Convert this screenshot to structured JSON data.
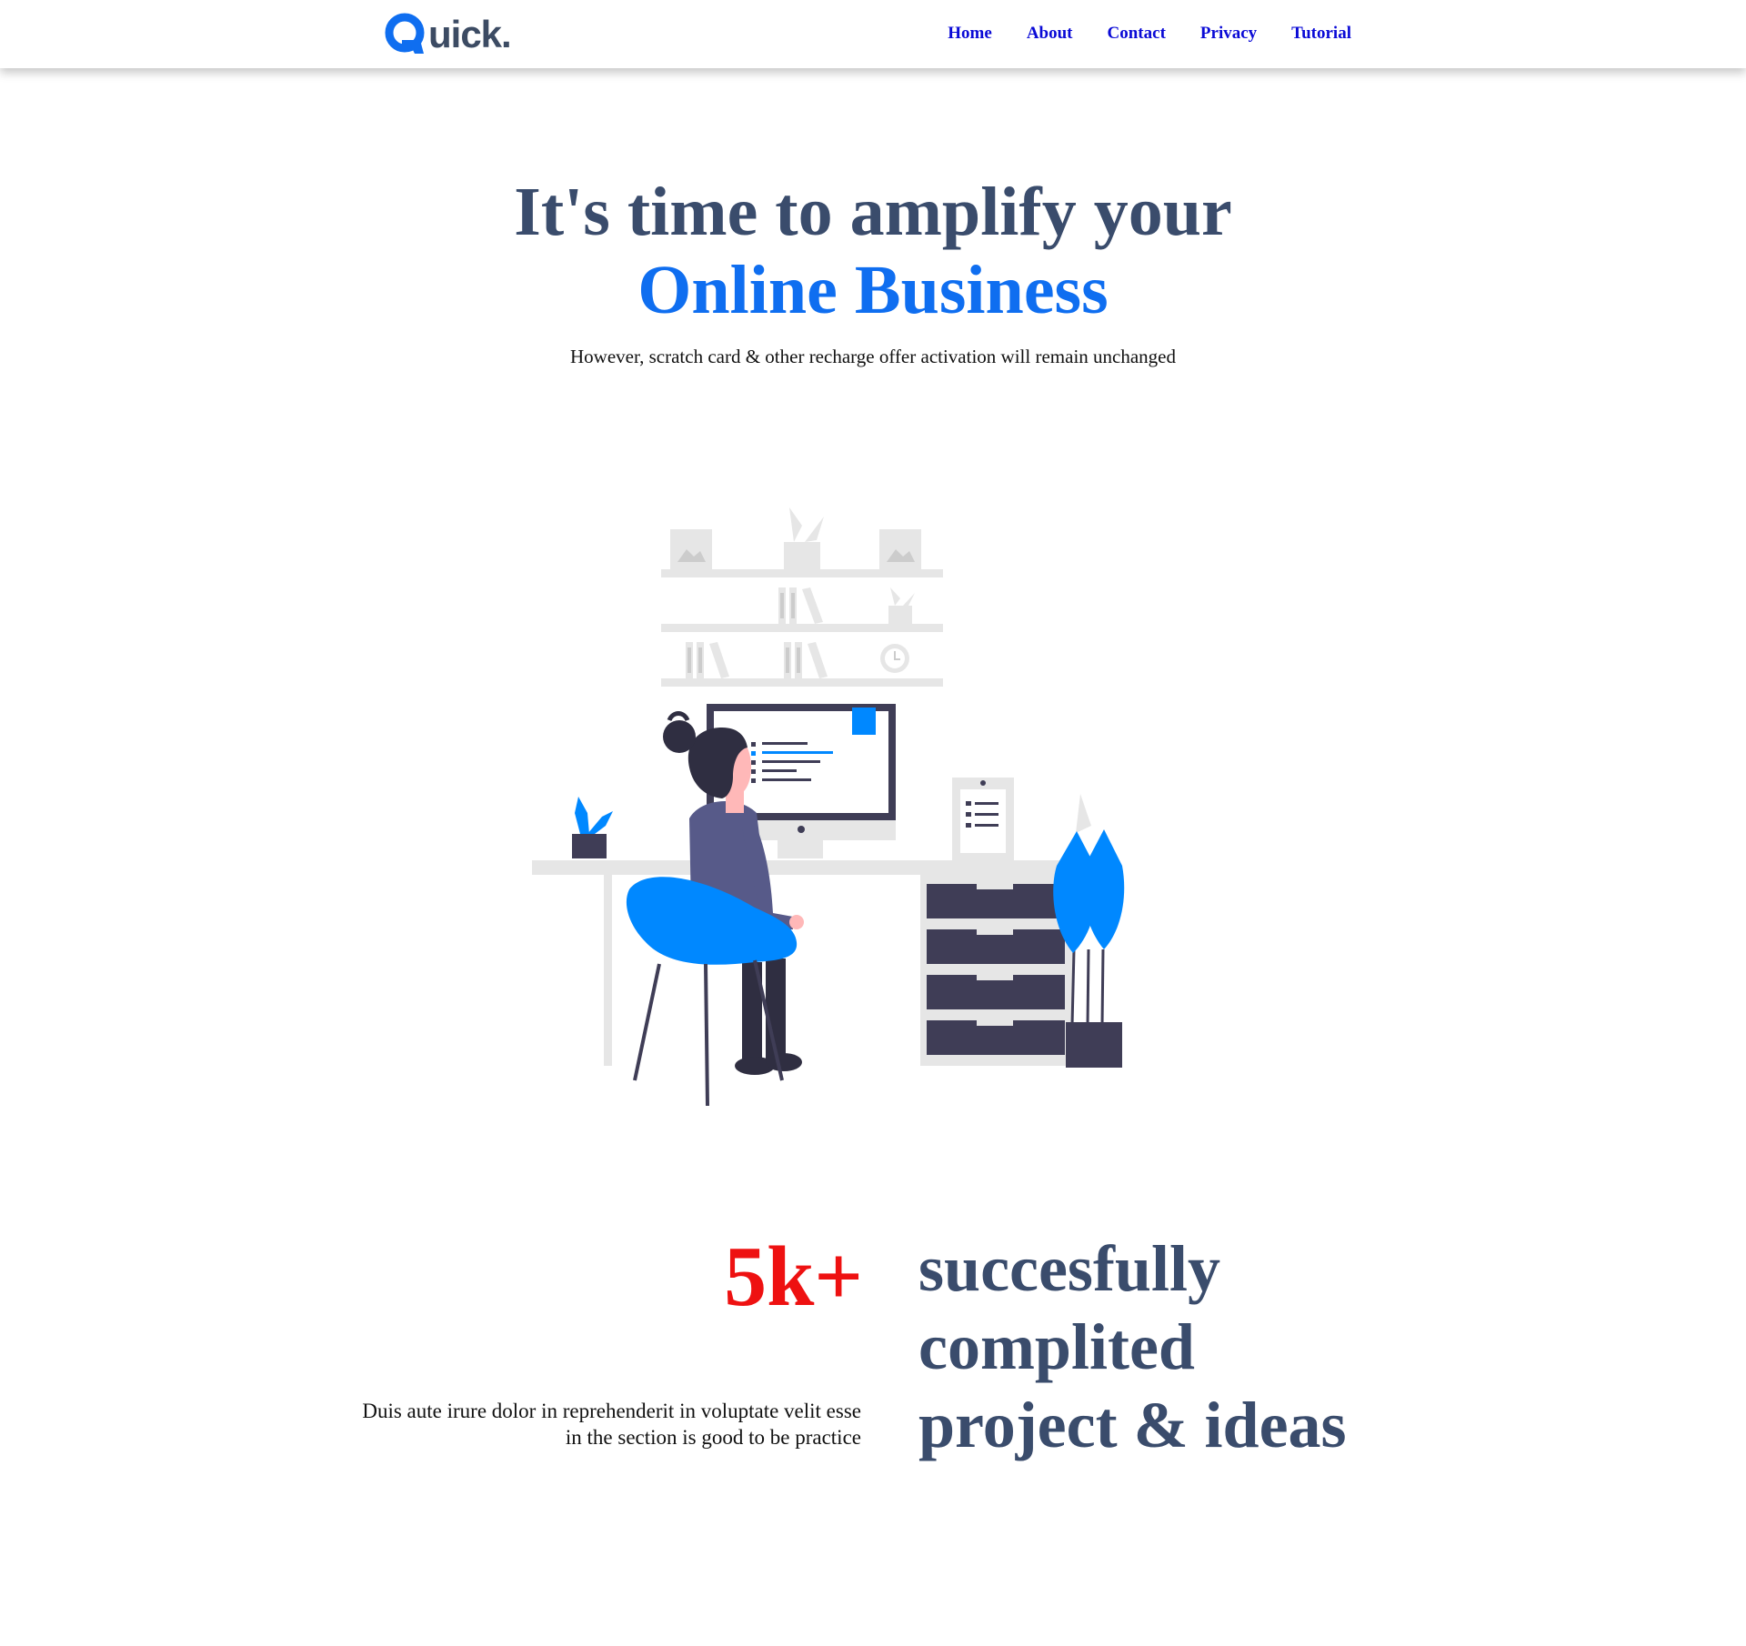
{
  "header": {
    "logo_text_first": "Q",
    "logo_text_rest": "uick.",
    "nav": [
      {
        "label": "Home"
      },
      {
        "label": "About"
      },
      {
        "label": "Contact"
      },
      {
        "label": "Privacy"
      },
      {
        "label": "Tutorial"
      }
    ]
  },
  "hero": {
    "title_line1": "It's time to amplify your",
    "title_line2": "Online Business",
    "subtitle": "However, scratch card & other recharge offer activation will remain unchanged"
  },
  "stats": {
    "number": "5k+",
    "description": "Duis aute irure dolor in reprehenderit in voluptate velit esse in the section is good to be practice",
    "heading_line1": "succesfully",
    "heading_line2": "complited",
    "heading_line3": "project & ideas"
  },
  "colors": {
    "brand_blue": "#0f6ef0",
    "heading_slate": "#3a4c6c",
    "nav_link": "#0a0ad6",
    "stat_red": "#ee1111",
    "illustration_gray": "#e6e6e6",
    "illustration_dark": "#3f3d56",
    "illustration_blue": "#0088ff"
  },
  "icons": {
    "logo": "quick-logo-icon",
    "illustration": "person-at-desk-illustration"
  }
}
